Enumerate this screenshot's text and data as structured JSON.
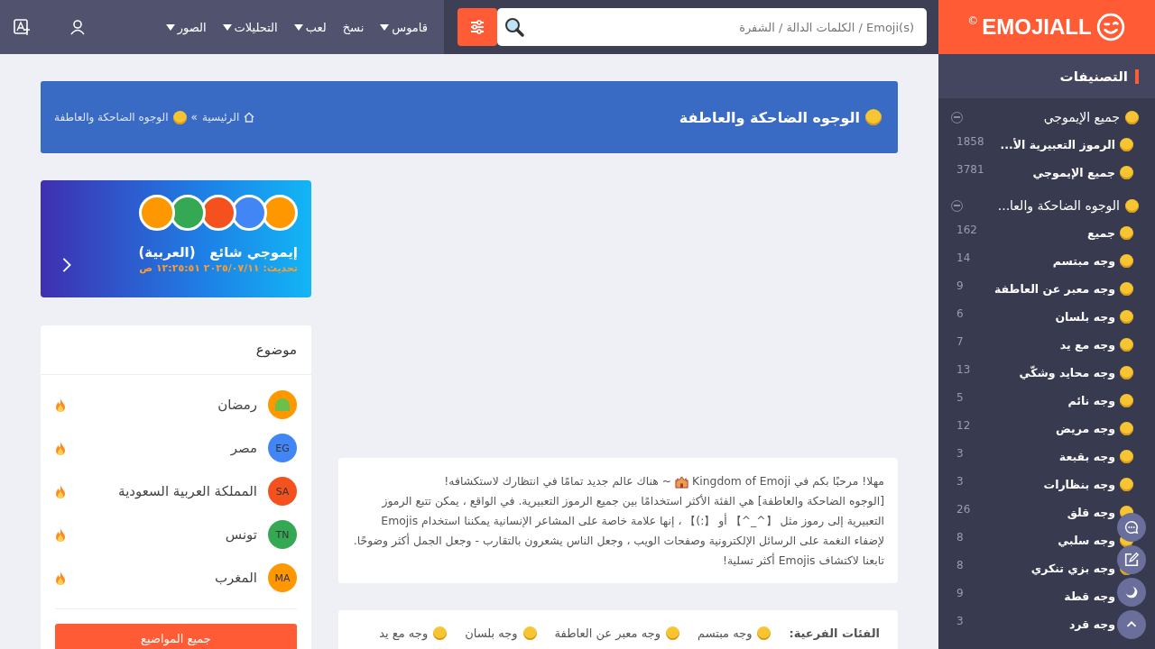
{
  "header": {
    "logo": "EMOJIALL",
    "logo_mark": "©",
    "search": {
      "placeholder": "Emoji(s) / الكلمات الدالة / الشفرة"
    },
    "nav": [
      {
        "label": "قاموس",
        "dropdown": true
      },
      {
        "label": "نسخ",
        "dropdown": false
      },
      {
        "label": "لعب",
        "dropdown": true
      },
      {
        "label": "التحليلات",
        "dropdown": true
      },
      {
        "label": "الصور",
        "dropdown": true
      }
    ]
  },
  "sidebar": {
    "title": "التصنيفات",
    "groups": [
      {
        "label": "جميع الإيموجي",
        "expanded": true,
        "items": [
          {
            "label": "الرموز التعبيرية الأ...",
            "count": "1858"
          },
          {
            "label": "جميع الإيموجي",
            "count": "3781"
          }
        ]
      },
      {
        "label": "الوجوه الضاحكة والعا...",
        "expanded": true,
        "items": [
          {
            "label": "جميع",
            "count": "162"
          },
          {
            "label": "وجه مبتسم",
            "count": "14"
          },
          {
            "label": "وجه معبر عن العاطفة",
            "count": "9"
          },
          {
            "label": "وجه بلسان",
            "count": "6"
          },
          {
            "label": "وجه مع يد",
            "count": "7"
          },
          {
            "label": "وجه محايد وشكّي",
            "count": "13"
          },
          {
            "label": "وجه نائم",
            "count": "5"
          },
          {
            "label": "وجه مريض",
            "count": "12"
          },
          {
            "label": "وجه بقبعة",
            "count": "3"
          },
          {
            "label": "وجه بنظارات",
            "count": "3"
          },
          {
            "label": "وجه قلق",
            "count": "26"
          },
          {
            "label": "وجه سلبي",
            "count": "8"
          },
          {
            "label": "وجه بزي تنكري",
            "count": "8"
          },
          {
            "label": "وجه قطة",
            "count": "9"
          },
          {
            "label": "وجه قرد",
            "count": "3"
          }
        ]
      }
    ]
  },
  "banner": {
    "title": "الوجوه الضاحكة والعاطفة",
    "breadcrumb": [
      {
        "label": "الرئيسية"
      },
      {
        "label": "الوجوه الضاحكة والعاطفة"
      }
    ],
    "separator": "»"
  },
  "trending": {
    "title": "إيموجي شائع   (العربية)",
    "updated": "تحديث: ٢٠٢٥/٠٧/١١ ١٢:٢٥:٥١ ص",
    "badges": [
      {
        "color": "#ff9800"
      },
      {
        "color": "#4285f4"
      },
      {
        "color": "#f4511e"
      },
      {
        "color": "#34a853"
      },
      {
        "color": "#ff9800"
      }
    ]
  },
  "topics": {
    "title": "موضوع",
    "items": [
      {
        "label": "رمضان",
        "kind": "icon",
        "color": "#ff9800"
      },
      {
        "label": "مصر",
        "kind": "code",
        "code": "EG",
        "color": "#4285f4"
      },
      {
        "label": "المملكة العربية السعودية",
        "kind": "code",
        "code": "SA",
        "color": "#f4511e"
      },
      {
        "label": "تونس",
        "kind": "code",
        "code": "TN",
        "color": "#34a853"
      },
      {
        "label": "المغرب",
        "kind": "code",
        "code": "MA",
        "color": "#ff9800"
      }
    ],
    "button": "جميع المواضيع"
  },
  "intro": {
    "before": "مهلا! مرحبًا بكم في Kingdom of Emoji",
    "after": "~ هناك عالم جديد تمامًا في انتظارك لاستكشافه!",
    "body": "[الوجوه الضاحكة والعاطفة] هي الفئة الأكثر استخدامًا بين جميع الرموز التعبيرية. في الواقع ، يمكن تتبع الرموز التعبيرية إلى رموز مثل 【^_^】 أو 【:)】 ، إنها علامة خاصة على المشاعر الإنسانية يمكننا استخدام Emojis لإضفاء النغمة على الرسائل الإلكترونية وصفحات الويب ، وجعل الناس يشعرون بالتقارب - وجعل الجمل أكثر وضوحًا. تابعنا لاكتشاف Emojis أكثر تسلية!"
  },
  "subcategories": {
    "label": "الفئات الفرعية:",
    "items": [
      {
        "label": "وجه مبتسم"
      },
      {
        "label": "وجه معبر عن العاطفة"
      },
      {
        "label": "وجه بلسان"
      },
      {
        "label": "وجه مع يد"
      }
    ]
  }
}
